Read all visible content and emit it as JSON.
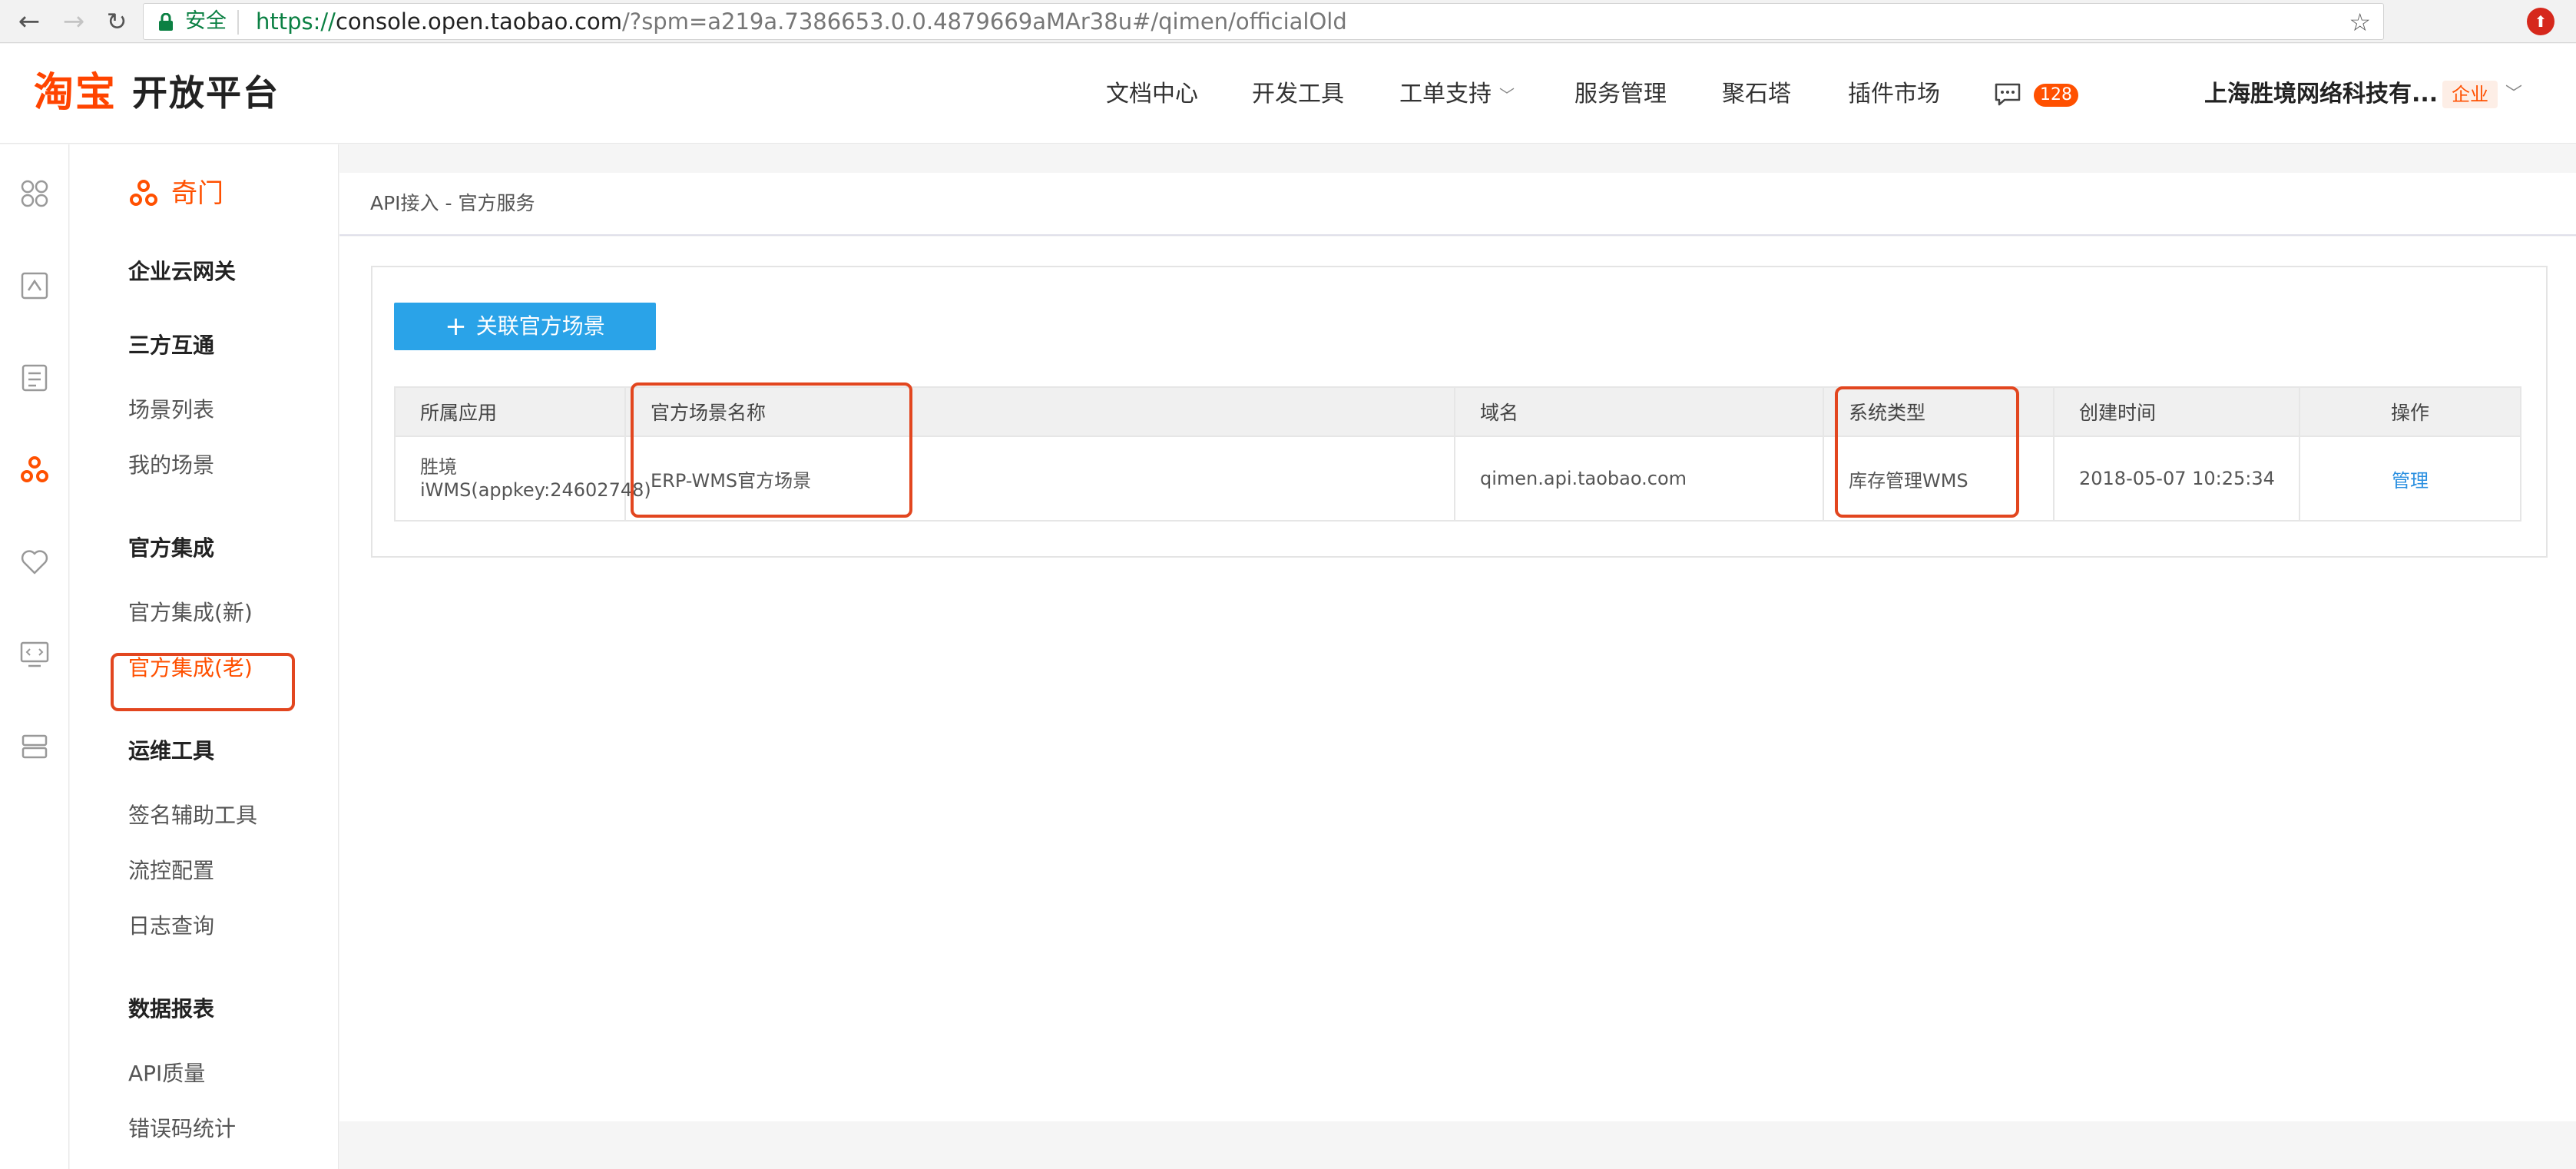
{
  "browser": {
    "secure_label": "安全",
    "url_scheme": "https://",
    "url_host": "console.open.taobao.com",
    "url_rest": "/?spm=a219a.7386653.0.0.4879669aMAr38u#/qimen/officialOld"
  },
  "header": {
    "logo": "淘宝",
    "platform": "开放平台",
    "nav": [
      "文档中心",
      "开发工具",
      "工单支持",
      "服务管理",
      "聚石塔",
      "插件市场"
    ],
    "message_count": "128",
    "company": "上海胜境网络科技有...",
    "company_tag": "企业"
  },
  "sidebar": {
    "title": "奇门",
    "groups": {
      "g1": "企业云网关",
      "g2": "三方互通",
      "g3": "官方集成",
      "g4": "运维工具",
      "g5": "数据报表"
    },
    "items": {
      "scene_list": "场景列表",
      "my_scene": "我的场景",
      "official_new": "官方集成(新)",
      "official_old": "官方集成(老)",
      "sign_tool": "签名辅助工具",
      "flow_control": "流控配置",
      "log_query": "日志查询",
      "api_quality": "API质量",
      "error_stats": "错误码统计"
    }
  },
  "main": {
    "breadcrumb": "API接入 - 官方服务",
    "add_button": "关联官方场景",
    "table": {
      "headers": [
        "所属应用",
        "官方场景名称",
        "域名",
        "系统类型",
        "创建时间",
        "操作"
      ],
      "rows": [
        {
          "app": "胜境iWMS(appkey:24602748)",
          "scene": "ERP-WMS官方场景",
          "domain": "qimen.api.taobao.com",
          "system_type": "库存管理WMS",
          "created": "2018-05-07 10:25:34",
          "action": "管理"
        }
      ]
    }
  },
  "colors": {
    "brand": "#ff5000",
    "primary_button": "#2aa3e8",
    "highlight": "#e2461f",
    "link": "#2a8fe0"
  }
}
